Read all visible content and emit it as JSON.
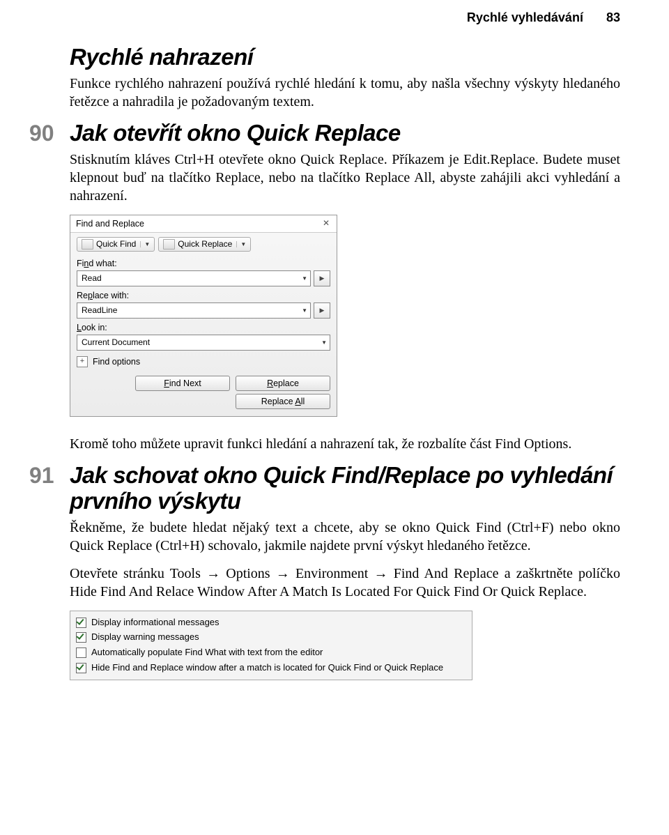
{
  "header": {
    "running_title": "Rychlé vyhledávání",
    "page_number": "83"
  },
  "sections": [
    {
      "number": "",
      "title": "Rychlé nahrazení",
      "paragraphs": [
        "Funkce rychlého nahrazení používá rychlé hledání k tomu, aby našla všechny výskyty hledaného řetězce a nahradila je požadovaným textem."
      ]
    },
    {
      "number": "90",
      "title": "Jak otevřít okno Quick Replace",
      "paragraphs": [
        "Stisknutím kláves Ctrl+H otevřete okno Quick Replace. Příkazem je Edit.Replace. Budete muset klepnout buď na tlačítko Replace, nebo na tlačítko Replace All, abyste zahájili akci vyhledání a nahrazení."
      ],
      "after_figure": [
        "Kromě toho můžete upravit funkci hledání a nahrazení tak, že rozbalíte část Find Options."
      ]
    },
    {
      "number": "91",
      "title": "Jak schovat okno Quick Find/Replace po vyhledání prvního výskytu",
      "paragraphs": [
        "Řekněme, že budete hledat nějaký text a chcete, aby se okno Quick Find (Ctrl+F) nebo okno Quick Replace (Ctrl+H) schovalo, jakmile najdete první výskyt hledaného řetězce.",
        "Otevřete stránku Tools → Options → Environment → Find And Replace a zaškrtněte políčko Hide Find And Relace Window After A Match Is Located For Quick Find Or Quick Replace."
      ]
    }
  ],
  "dialog": {
    "title": "Find and Replace",
    "tab_quick_find": "Quick Find",
    "tab_quick_replace": "Quick Replace",
    "label_find_what_pre": "Fi",
    "label_find_what_u": "n",
    "label_find_what_post": "d what:",
    "value_find_what": "Read",
    "label_replace_with_pre": "Re",
    "label_replace_with_u": "p",
    "label_replace_with_post": "lace with:",
    "value_replace_with": "ReadLine",
    "label_look_in_u": "L",
    "label_look_in_post": "ook in:",
    "value_look_in": "Current Document",
    "expander_label": "Find options",
    "btn_find_next_u": "F",
    "btn_find_next_post": "ind Next",
    "btn_replace_u": "R",
    "btn_replace_post": "eplace",
    "btn_replace_all_pre": "Replace ",
    "btn_replace_all_u": "A",
    "btn_replace_all_post": "ll"
  },
  "checkboxes": {
    "items": [
      {
        "checked": true,
        "label": "Display informational messages"
      },
      {
        "checked": true,
        "label": "Display warning messages"
      },
      {
        "checked": false,
        "label": "Automatically populate Find What with text from the editor"
      },
      {
        "checked": true,
        "label": "Hide Find and Replace window after a match is located for Quick Find or Quick Replace"
      }
    ]
  }
}
